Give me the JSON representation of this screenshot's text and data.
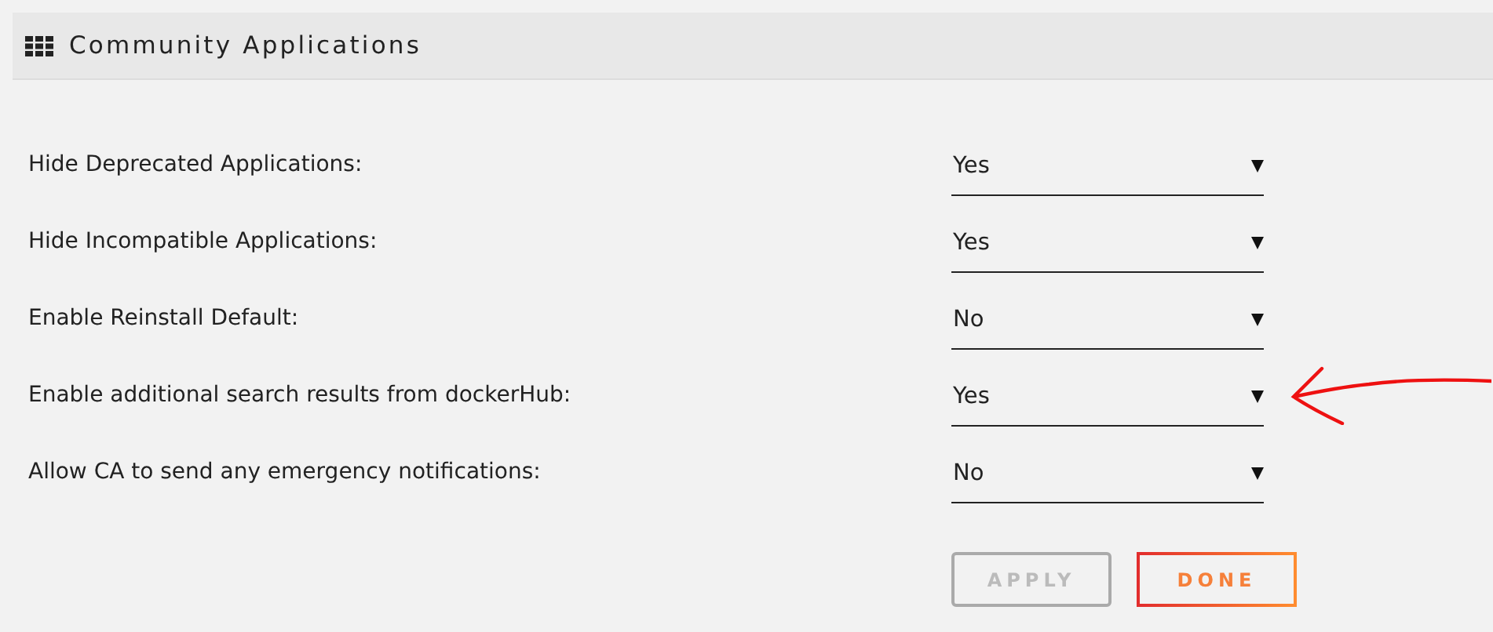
{
  "header": {
    "title": "Community Applications"
  },
  "settings": [
    {
      "label": "Hide Deprecated Applications:",
      "value": "Yes"
    },
    {
      "label": "Hide Incompatible Applications:",
      "value": "Yes"
    },
    {
      "label": "Enable Reinstall Default:",
      "value": "No"
    },
    {
      "label": "Enable additional search results from dockerHub:",
      "value": "Yes"
    },
    {
      "label": "Allow CA to send any emergency notifications:",
      "value": "No"
    }
  ],
  "buttons": [
    {
      "label": "APPLY",
      "disabled": true
    },
    {
      "label": "DONE",
      "disabled": false
    }
  ]
}
